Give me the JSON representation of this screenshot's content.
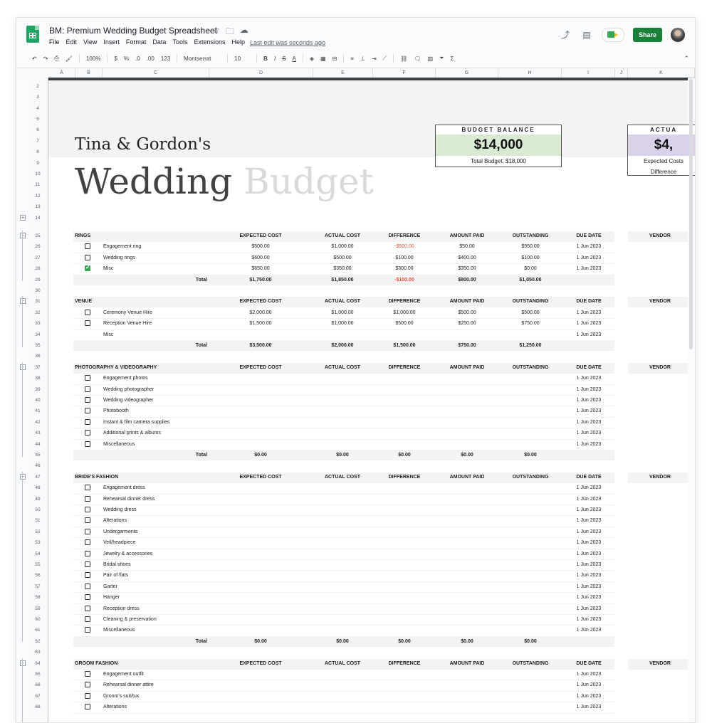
{
  "header": {
    "title": "BM: Premium Wedding Budget Spreadsheet",
    "menu": [
      "File",
      "Edit",
      "View",
      "Insert",
      "Format",
      "Data",
      "Tools",
      "Extensions",
      "Help"
    ],
    "last_edit": "Last edit was seconds ago",
    "share_label": "Share",
    "icons": [
      "star-icon",
      "move-folder-icon",
      "cloud-status-icon",
      "trending-icon",
      "comment-icon",
      "meet-icon"
    ]
  },
  "toolbar": {
    "zoom": "100%",
    "currency": "$",
    "percent": "%",
    "dec_decrease": ".0",
    "dec_increase": ".00",
    "number_format": "123",
    "font": "Montserrat",
    "font_size": "10",
    "bold": "B",
    "italic": "I",
    "strike": "S",
    "text_color": "A"
  },
  "columns": [
    "A",
    "B",
    "C",
    "D",
    "E",
    "F",
    "G",
    "H",
    "I",
    "J",
    "K"
  ],
  "hero": {
    "names": "Tina & Gordon's",
    "title_word1": "Wedding",
    "title_word2": "Budget"
  },
  "budget_balance": {
    "label": "BUDGET BALANCE",
    "value": "$14,000",
    "total_label": "Total Budget:",
    "total_value": "$18,000",
    "accent": "#d9ead3"
  },
  "actual_card": {
    "label": "ACTUA",
    "value": "$4,",
    "line1": "Expected Costs",
    "line2": "Difference",
    "accent": "#d9d2e9"
  },
  "headers": {
    "expected": "EXPECTED COST",
    "actual": "ACTUAL COST",
    "difference": "DIFFERENCE",
    "paid": "AMOUNT PAID",
    "outstanding": "OUTSTANDING",
    "due": "DUE DATE",
    "vendor": "VENDOR",
    "total": "Total"
  },
  "rows": [
    {
      "row": "2",
      "type": "blank"
    },
    {
      "row": "3",
      "type": "blank"
    },
    {
      "row": "4",
      "type": "blank"
    },
    {
      "row": "5",
      "type": "blank"
    },
    {
      "row": "6",
      "type": "blank"
    },
    {
      "row": "7",
      "type": "blank"
    },
    {
      "row": "8",
      "type": "blank"
    },
    {
      "row": "9",
      "type": "blank"
    },
    {
      "row": "10",
      "type": "blank"
    },
    {
      "row": "11",
      "type": "blank"
    },
    {
      "row": "12",
      "type": "blank"
    },
    {
      "row": "13",
      "type": "blank"
    },
    {
      "row": "14",
      "type": "blank"
    },
    {
      "row": "25",
      "type": "section",
      "name": "RINGS"
    },
    {
      "row": "26",
      "type": "item",
      "cb": "off",
      "name": "Engagement ring",
      "expected": "$500.00",
      "actual": "$1,000.00",
      "diff": "-$500.00",
      "diff_neg": true,
      "paid": "$50.00",
      "outstanding": "$950.00",
      "due": "1 Jun 2023"
    },
    {
      "row": "27",
      "type": "item",
      "cb": "off",
      "name": "Wedding rings",
      "expected": "$600.00",
      "actual": "$500.00",
      "diff": "$100.00",
      "paid": "$400.00",
      "outstanding": "$100.00",
      "due": "1 Jun 2023"
    },
    {
      "row": "28",
      "type": "item",
      "cb": "on",
      "name": "Misc",
      "expected": "$650.00",
      "actual": "$350.00",
      "diff": "$300.00",
      "paid": "$350.00",
      "outstanding": "$0.00",
      "due": "1 Jun 2023"
    },
    {
      "row": "29",
      "type": "total",
      "expected": "$1,750.00",
      "actual": "$1,850.00",
      "diff": "-$100.00",
      "diff_neg": true,
      "paid": "$800.00",
      "outstanding": "$1,050.00"
    },
    {
      "row": "30",
      "type": "blank"
    },
    {
      "row": "31",
      "type": "section",
      "name": "VENUE"
    },
    {
      "row": "32",
      "type": "item",
      "cb": "off",
      "name": "Ceremony Venue Hire",
      "expected": "$2,000.00",
      "actual": "$1,000.00",
      "diff": "$1,000.00",
      "paid": "$500.00",
      "outstanding": "$500.00",
      "due": "1 Jun 2023"
    },
    {
      "row": "33",
      "type": "item",
      "cb": "off",
      "name": "Reception Venue Hire",
      "expected": "$1,500.00",
      "actual": "$1,000.00",
      "diff": "$500.00",
      "paid": "$250.00",
      "outstanding": "$750.00",
      "due": "1 Jun 2023"
    },
    {
      "row": "34",
      "type": "item",
      "cb": "none",
      "name": "Misc",
      "due": "1 Jun 2023"
    },
    {
      "row": "35",
      "type": "total",
      "expected": "$3,500.00",
      "actual": "$2,000.00",
      "diff": "$1,500.00",
      "paid": "$750.00",
      "outstanding": "$1,250.00"
    },
    {
      "row": "36",
      "type": "blank"
    },
    {
      "row": "37",
      "type": "section",
      "name": "PHOTOGRAPHY & VIDEOGRAPHY"
    },
    {
      "row": "38",
      "type": "item",
      "cb": "off",
      "name": "Engagement photos",
      "due": "1 Jun 2023"
    },
    {
      "row": "39",
      "type": "item",
      "cb": "off",
      "name": "Wedding photographer",
      "due": "1 Jun 2023"
    },
    {
      "row": "40",
      "type": "item",
      "cb": "off",
      "name": "Wedding videographer",
      "due": "1 Jun 2023"
    },
    {
      "row": "41",
      "type": "item",
      "cb": "off",
      "name": "Photobooth",
      "due": "1 Jun 2023"
    },
    {
      "row": "42",
      "type": "item",
      "cb": "off",
      "name": "Instant & film camera supplies",
      "due": "1 Jun 2023"
    },
    {
      "row": "43",
      "type": "item",
      "cb": "off",
      "name": "Additional prints & albums",
      "due": "1 Jun 2023"
    },
    {
      "row": "44",
      "type": "item",
      "cb": "off",
      "name": "Miscellaneous",
      "due": "1 Jun 2023"
    },
    {
      "row": "45",
      "type": "total",
      "expected": "$0.00",
      "actual": "$0.00",
      "diff": "$0.00",
      "paid": "$0.00",
      "outstanding": "$0.00"
    },
    {
      "row": "46",
      "type": "blank"
    },
    {
      "row": "47",
      "type": "section",
      "name": "BRIDE'S FASHION"
    },
    {
      "row": "48",
      "type": "item",
      "cb": "off",
      "name": "Engagement dress",
      "due": "1 Jun 2023"
    },
    {
      "row": "49",
      "type": "item",
      "cb": "off",
      "name": "Rehearsal dinner dress",
      "due": "1 Jun 2023"
    },
    {
      "row": "50",
      "type": "item",
      "cb": "off",
      "name": "Wedding dress",
      "due": "1 Jun 2023"
    },
    {
      "row": "51",
      "type": "item",
      "cb": "off",
      "name": "Alterations",
      "due": "1 Jun 2023"
    },
    {
      "row": "52",
      "type": "item",
      "cb": "off",
      "name": "Undergarments",
      "due": "1 Jun 2023"
    },
    {
      "row": "53",
      "type": "item",
      "cb": "off",
      "name": "Veil/headpiece",
      "due": "1 Jun 2023"
    },
    {
      "row": "54",
      "type": "item",
      "cb": "off",
      "name": "Jewelry & accessories",
      "due": "1 Jun 2023"
    },
    {
      "row": "55",
      "type": "item",
      "cb": "off",
      "name": "Bridal shoes",
      "due": "1 Jun 2023"
    },
    {
      "row": "56",
      "type": "item",
      "cb": "off",
      "name": "Pair of flats",
      "due": "1 Jun 2023"
    },
    {
      "row": "57",
      "type": "item",
      "cb": "off",
      "name": "Garter",
      "due": "1 Jun 2023"
    },
    {
      "row": "58",
      "type": "item",
      "cb": "off",
      "name": "Hanger",
      "due": "1 Jun 2023"
    },
    {
      "row": "59",
      "type": "item",
      "cb": "off",
      "name": "Reception dress",
      "due": "1 Jun 2023"
    },
    {
      "row": "60",
      "type": "item",
      "cb": "off",
      "name": "Cleaning & preservation",
      "due": "1 Jun 2023"
    },
    {
      "row": "61",
      "type": "item",
      "cb": "off",
      "name": "Miscellaneous",
      "due": "1 Jun 2023"
    },
    {
      "row": "62",
      "type": "total",
      "expected": "$0.00",
      "actual": "$0.00",
      "diff": "$0.00",
      "paid": "$0.00",
      "outstanding": "$0.00"
    },
    {
      "row": "63",
      "type": "blank"
    },
    {
      "row": "64",
      "type": "section",
      "name": "GROOM FASHION"
    },
    {
      "row": "65",
      "type": "item",
      "cb": "off",
      "name": "Engagement outfit",
      "due": "1 Jun 2023"
    },
    {
      "row": "66",
      "type": "item",
      "cb": "off",
      "name": "Rehearsal dinner attire",
      "due": "1 Jun 2023"
    },
    {
      "row": "67",
      "type": "item",
      "cb": "off",
      "name": "Groom's suit/tux",
      "due": "1 Jun 2023"
    },
    {
      "row": "68",
      "type": "item",
      "cb": "off",
      "name": "Alterations",
      "due": "1 Jun 2023"
    }
  ],
  "groups": {
    "collapsed_button": "+",
    "expanded_button": "−"
  }
}
